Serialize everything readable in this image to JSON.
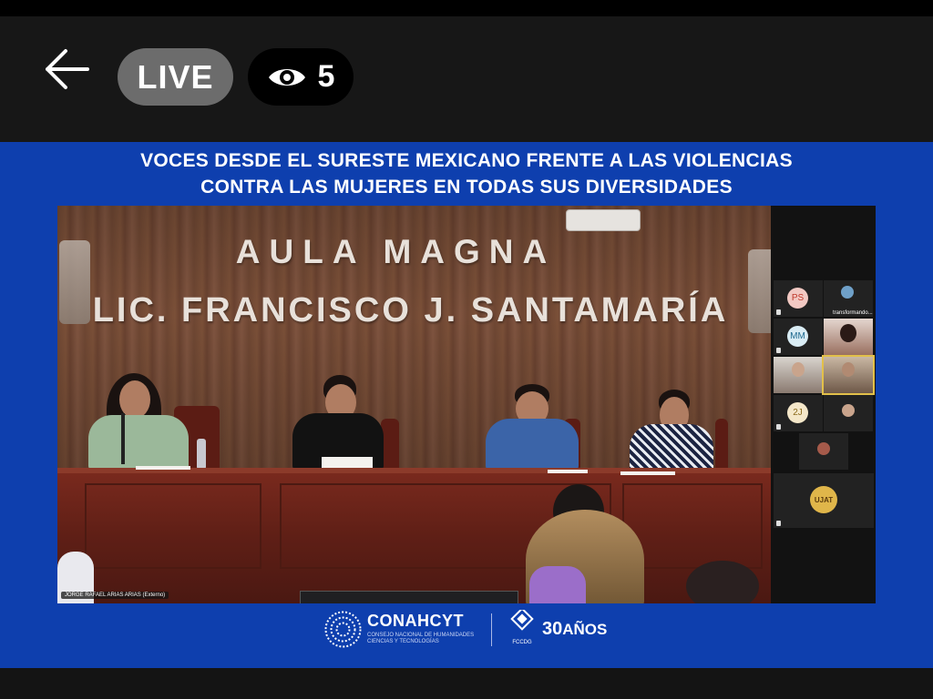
{
  "header": {
    "back_label": "Back",
    "live_label": "LIVE",
    "viewer_count": "5"
  },
  "banner": {
    "line1": "VOCES DESDE EL SURESTE MEXICANO FRENTE A LAS VIOLENCIAS",
    "line2": "CONTRA LAS MUJERES EN TODAS SUS DIVERSIDADES"
  },
  "video": {
    "wall_sign_line1": "AULA  MAGNA",
    "wall_sign_line2": "LIC. FRANCISCO J. SANTAMARÍA",
    "speaker_nameplate": "JORGE RAFAEL ARIAS ARIAS (Externo)"
  },
  "gallery": {
    "tiles": [
      {
        "initials": "PS",
        "avatar_color": "#f2c9c3",
        "text_color": "#c0392b"
      },
      {
        "initials": "",
        "label": "transformando..."
      },
      {
        "initials": "MM",
        "avatar_color": "#d9ecf4",
        "text_color": "#1e6a8f"
      },
      {
        "initials": "",
        "label": ""
      },
      {
        "initials": "",
        "label": ""
      },
      {
        "initials": "",
        "label": ""
      },
      {
        "initials": "2J",
        "avatar_color": "#f4e7c9",
        "text_color": "#8a6a1c"
      },
      {
        "initials": "",
        "label": ""
      },
      {
        "initials": "",
        "label": ""
      },
      {
        "initials": "UJAT",
        "avatar_color": "#e0b64a",
        "text_color": "#5b3b0d"
      }
    ]
  },
  "footer": {
    "org_name": "CONAHCYT",
    "org_subtitle": "CONSEJO NACIONAL DE HUMANIDADES CIENCIAS Y TECNOLOGÍAS",
    "partner_label": "FCCDG",
    "anniversary_num": "30",
    "anniversary_word": "AÑOS"
  },
  "colors": {
    "stage_blue": "#0e3fae",
    "live_pill": "#6c6c6c",
    "header_bg": "#171717",
    "selected_tile_outline": "#e2c04a"
  }
}
